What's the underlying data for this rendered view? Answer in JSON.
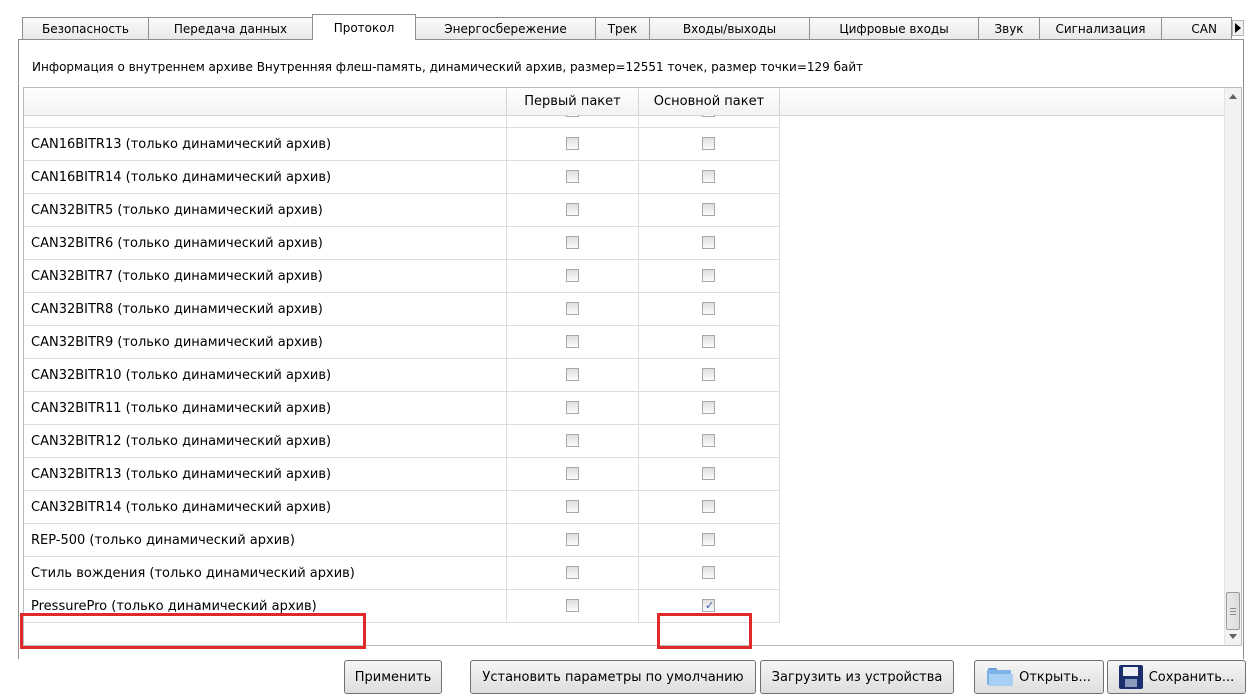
{
  "tabs": [
    {
      "label": "Безопасность",
      "active": false
    },
    {
      "label": "Передача данных",
      "active": false
    },
    {
      "label": "Протокол",
      "active": true
    },
    {
      "label": "Энергосбережение",
      "active": false
    },
    {
      "label": "Трек",
      "active": false
    },
    {
      "label": "Входы/выходы",
      "active": false
    },
    {
      "label": "Цифровые входы",
      "active": false
    },
    {
      "label": "Звук",
      "active": false
    },
    {
      "label": "Сигнализация",
      "active": false
    },
    {
      "label": "CAN",
      "active": false
    }
  ],
  "archive_info": "Информация о внутреннем архиве  Внутренняя флеш-память, динамический архив, размер=12551 точек, размер точки=129 байт",
  "grid": {
    "columns": {
      "name": "",
      "first": "Первый пакет",
      "main": "Основной пакет"
    },
    "rows": [
      {
        "name": "",
        "first": false,
        "main": false
      },
      {
        "name": "CAN16BITR13 (только динамический архив)",
        "first": false,
        "main": false
      },
      {
        "name": "CAN16BITR14 (только динамический архив)",
        "first": false,
        "main": false
      },
      {
        "name": "CAN32BITR5 (только динамический архив)",
        "first": false,
        "main": false
      },
      {
        "name": "CAN32BITR6 (только динамический архив)",
        "first": false,
        "main": false
      },
      {
        "name": "CAN32BITR7 (только динамический архив)",
        "first": false,
        "main": false
      },
      {
        "name": "CAN32BITR8 (только динамический архив)",
        "first": false,
        "main": false
      },
      {
        "name": "CAN32BITR9 (только динамический архив)",
        "first": false,
        "main": false
      },
      {
        "name": "CAN32BITR10 (только динамический архив)",
        "first": false,
        "main": false
      },
      {
        "name": "CAN32BITR11 (только динамический архив)",
        "first": false,
        "main": false
      },
      {
        "name": "CAN32BITR12 (только динамический архив)",
        "first": false,
        "main": false
      },
      {
        "name": "CAN32BITR13 (только динамический архив)",
        "first": false,
        "main": false
      },
      {
        "name": "CAN32BITR14 (только динамический архив)",
        "first": false,
        "main": false
      },
      {
        "name": "REP-500 (только динамический архив)",
        "first": false,
        "main": false
      },
      {
        "name": "Стиль вождения (только динамический архив)",
        "first": false,
        "main": false
      },
      {
        "name": "PressurePro (только динамический архив)",
        "first": false,
        "main": true
      }
    ]
  },
  "buttons": {
    "apply": "Применить",
    "defaults": "Установить параметры по умолчанию",
    "load": "Загрузить из устройства",
    "open": "Открыть...",
    "save": "Сохранить..."
  },
  "colors": {
    "highlight": "#e02a2a",
    "check": "#3b5aa8"
  }
}
